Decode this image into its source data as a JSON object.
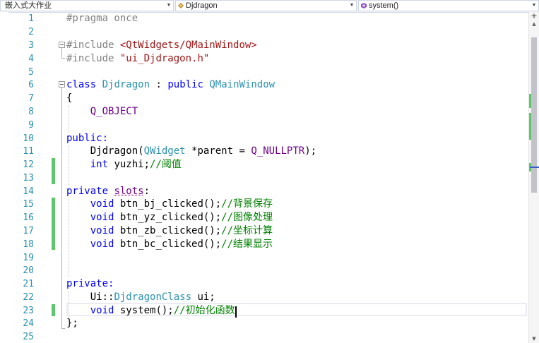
{
  "navbar": {
    "project": "嵌入式大作业",
    "class_name": "Djdragon",
    "member": "system()"
  },
  "editor": {
    "line_numbers": [
      "1",
      "2",
      "3",
      "4",
      "5",
      "6",
      "7",
      "8",
      "9",
      "10",
      "11",
      "12",
      "13",
      "14",
      "15",
      "16",
      "17",
      "18",
      "19",
      "20",
      "21",
      "22",
      "23",
      "24",
      "25"
    ],
    "colors": {
      "keyword": "#0000ff",
      "macro": "#6f008a",
      "string": "#a31515",
      "comment": "#008000",
      "type": "#2b91af",
      "change_bar": "#5dc86b"
    }
  },
  "code": {
    "l1": "#pragma once",
    "l3_kw": "#include",
    "l3_str": "<QtWidgets/QMainWindow>",
    "l4_kw": "#include",
    "l4_str": "\"ui_Djdragon.h\"",
    "l6_kw": "class",
    "l6_name": "Djdragon",
    "l6_colon": ":",
    "l6_kw2": "public",
    "l6_base": "QMainWindow",
    "l7": "{",
    "l8": "Q_OBJECT",
    "l10": "public:",
    "l11_a": "Djdragon(",
    "l11_type": "QWidget",
    "l11_b": "*parent",
    "l11_c": "=",
    "l11_macro": "Q_NULLPTR",
    "l11_d": ");",
    "l12_kw": "int",
    "l12_a": "yuzhi;",
    "l12_cmt": "//阈值",
    "l14_kw": "private",
    "l14_slots": "slots",
    "l14_colon": ":",
    "l15_kw": "void",
    "l15_a": "btn_bj_clicked();",
    "l15_cmt": "//背景保存",
    "l16_kw": "void",
    "l16_a": "btn_yz_clicked();",
    "l16_cmt": "//图像处理",
    "l17_kw": "void",
    "l17_a": "btn_zb_clicked();",
    "l17_cmt": "//坐标计算",
    "l18_kw": "void",
    "l18_a": "btn_bc_clicked();",
    "l18_cmt": "//结果显示",
    "l21": "private:",
    "l22_a": "Ui::",
    "l22_type": "DjdragonClass",
    "l22_b": "ui;",
    "l23_kw": "void",
    "l23_a": "system();",
    "l23_cmt": "//初始化函数",
    "l24": "};"
  },
  "scrollbar": {
    "split_label": "+"
  }
}
